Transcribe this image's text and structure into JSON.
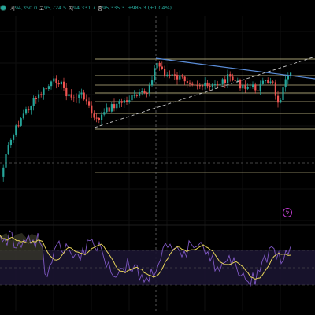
{
  "ohlc": {
    "open_label": "시",
    "open": "94,350.0",
    "high_label": "고",
    "high": "95,724.5",
    "low_label": "저",
    "low": "94,331.7",
    "close_label": "종",
    "close": "95,335.3",
    "change": "+985.3 (+1.04%)"
  },
  "colors": {
    "up": "#26a69a",
    "down": "#ef5350",
    "hline": "#f0e6a8",
    "trendline": "#5b8dd9",
    "dashed_trend": "#c8c8c8",
    "rsi_line": "#7e57c2",
    "rsi_ma": "#e6d35a",
    "rsi_band": "#1a1430",
    "alert": "#c03ad0"
  },
  "icons": {
    "status": "status-dot-icon",
    "alert": "lightning-alert-icon"
  }
}
